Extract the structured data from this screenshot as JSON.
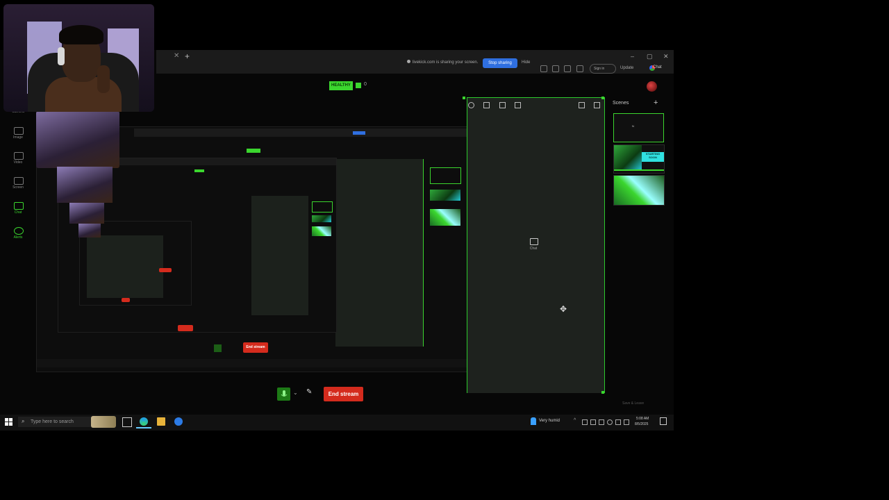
{
  "browser": {
    "share_message": "livekick.com is sharing your screen.",
    "stop_sharing": "Stop sharing",
    "hide": "Hide",
    "sign_in": "Sign in",
    "update": "Update",
    "chat": "Chat"
  },
  "header": {
    "status_badge": "HEALTHY",
    "viewer_count": "0"
  },
  "sidebar": {
    "items": [
      {
        "label": "Camera"
      },
      {
        "label": "Image"
      },
      {
        "label": "Video"
      },
      {
        "label": "Screen"
      },
      {
        "label": "Chat"
      },
      {
        "label": "Alerts"
      }
    ]
  },
  "canvas": {
    "chat_widget_label": "Chat"
  },
  "scenes": {
    "title": "Scenes",
    "add": "+",
    "items": [
      {
        "name": "scene-blank",
        "selected": true,
        "caption": "N"
      },
      {
        "name": "scene-starting-soon",
        "selected": false,
        "caption": "STARTING SOON"
      },
      {
        "name": "scene-brb",
        "selected": false,
        "caption": ""
      }
    ],
    "save_label": "Save & Leave"
  },
  "controls": {
    "end_stream": "End stream",
    "mic_dropdown": "⌄"
  },
  "nested": {
    "end_stream": "End stream",
    "status_badge": "HEALTHY"
  },
  "taskbar": {
    "search_placeholder": "Type here to search",
    "weather": "Very humid",
    "time": "5:08 AM",
    "date": "8/5/2025"
  },
  "colors": {
    "accent": "#3bd62e",
    "danger": "#d42b1d",
    "share_blue": "#2f6fe0"
  }
}
